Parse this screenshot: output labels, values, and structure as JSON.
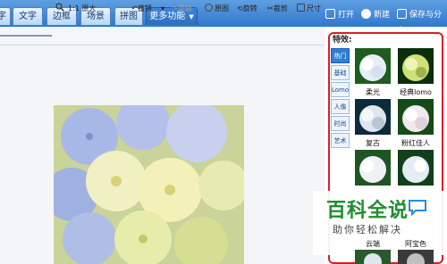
{
  "tabs": [
    {
      "label": "字",
      "active": false
    },
    {
      "label": "文字",
      "active": false
    },
    {
      "label": "边框",
      "active": false
    },
    {
      "label": "场景",
      "active": false
    },
    {
      "label": "拼图",
      "active": false
    },
    {
      "label": "更多功能",
      "active": true
    }
  ],
  "top_right": {
    "open": "打开",
    "new": "新建",
    "save": "保存与分享"
  },
  "toolbar": {
    "original_size": "1:1 原大",
    "undo": "撤销",
    "redo": "重做",
    "reset": "原图",
    "rotate": "旋转",
    "crop": "裁剪",
    "resize": "尺寸"
  },
  "effects": {
    "title": "特效:",
    "categories": [
      "热门",
      "基础",
      "Lomo",
      "人像",
      "时尚",
      "艺术"
    ],
    "active_category": "热门",
    "thumbnails": [
      {
        "label": "柔光"
      },
      {
        "label": "经典lomo"
      },
      {
        "label": "复古"
      },
      {
        "label": "粉红佳人"
      },
      {
        "label": ""
      },
      {
        "label": ""
      },
      {
        "label": "云端"
      },
      {
        "label": "阿宝色"
      }
    ]
  },
  "watermark": {
    "title": "百科全说",
    "subtitle": "助你轻松解决"
  },
  "colors": {
    "accent": "#2f78cf",
    "highlight_border": "#d81e2a",
    "brand_green": "#1f8d2f"
  }
}
